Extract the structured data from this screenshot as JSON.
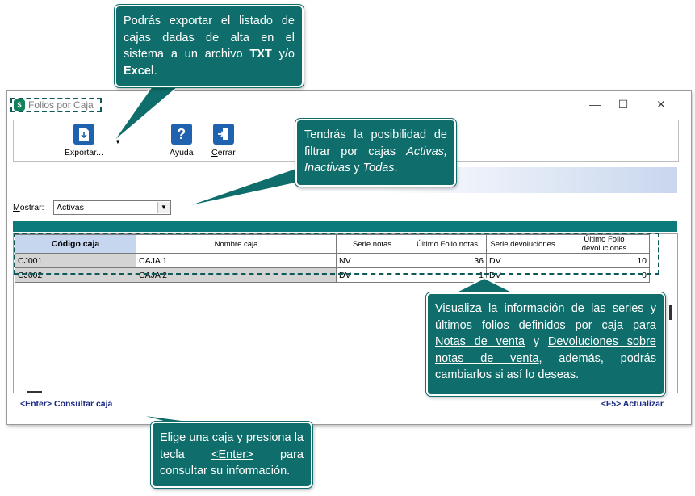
{
  "window": {
    "title": "Folios por Caja",
    "controls": {
      "minimize": "—",
      "maximize": "☐",
      "close": "✕"
    }
  },
  "toolbar": {
    "export_label_prefix": "Exportar",
    "export_label_suffix": "...",
    "help_label": "Ayuda",
    "close_label_first": "C",
    "close_label_rest": "errar",
    "export_arrow": "▼"
  },
  "filter": {
    "label_first": "M",
    "label_rest": "ostrar:",
    "selected": "Activas",
    "arrow": "▼"
  },
  "grid": {
    "columns": [
      "Código caja",
      "Nombre caja",
      "Serie notas",
      "Último Folio notas",
      "Serie devoluciones",
      "Último Folio devoluciones"
    ],
    "rows": [
      [
        "CJ001",
        "CAJA 1",
        "NV",
        "36",
        "DV",
        "10"
      ],
      [
        "CJ002",
        "CAJA 2",
        "DV",
        "1",
        "DV",
        "0"
      ]
    ]
  },
  "status": {
    "left": "<Enter> Consultar caja",
    "right": "<F5> Actualizar"
  },
  "callouts": {
    "export": {
      "t1": "Podrás exportar el listado de cajas dadas de alta en el sistema a un archivo ",
      "b1": "TXT",
      "t2": " y/o ",
      "b2": "Excel",
      "t3": "."
    },
    "filter": {
      "t1": "Tendrás la posibilidad de filtrar por cajas ",
      "i1": "Activas,",
      "t2": " ",
      "i2": "Inactivas",
      "t3": " y ",
      "i3": "Todas",
      "t4": "."
    },
    "series": {
      "t1": "Visualiza la información de las series y últimos folios definidos por caja para ",
      "u1": "Notas de venta",
      "t2": " y ",
      "u2": "Devoluciones sobre notas de venta",
      "t3": ", además, podrás cambiarlos si así lo deseas."
    },
    "enter": {
      "t1": "Elige una caja y presiona la tecla ",
      "u1": "<Enter>",
      "t2": " para consultar su información."
    }
  },
  "colors": {
    "teal": "#0f6e6b",
    "status_text": "#1c2a84",
    "header_highlight": "#c7d6ef"
  }
}
